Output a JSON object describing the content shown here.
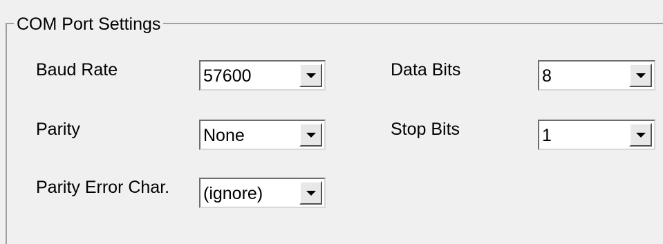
{
  "group": {
    "title": "COM Port Settings"
  },
  "fields": {
    "baud_rate": {
      "label": "Baud Rate",
      "value": "57600"
    },
    "data_bits": {
      "label": "Data Bits",
      "value": "8"
    },
    "parity": {
      "label": "Parity",
      "value": "None"
    },
    "stop_bits": {
      "label": "Stop Bits",
      "value": "1"
    },
    "parity_error_char": {
      "label": "Parity Error Char.",
      "value": "(ignore)"
    }
  },
  "icons": {
    "dropdown": "chevron-down-icon"
  },
  "colors": {
    "background": "#f0f0f0",
    "field_background": "#ffffff",
    "border": "#a0a0a0"
  }
}
